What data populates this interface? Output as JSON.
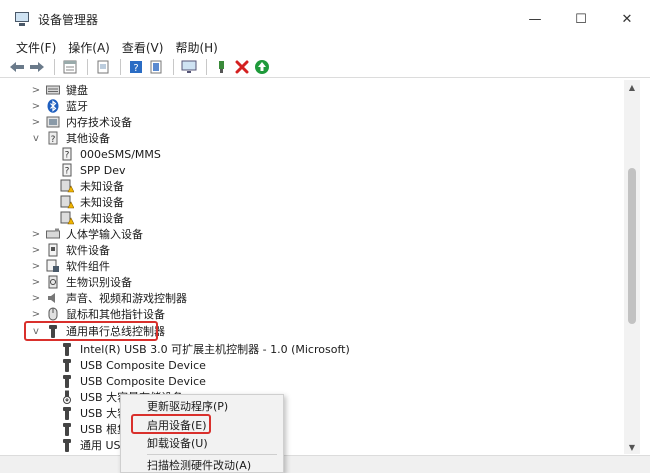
{
  "window": {
    "title": "设备管理器",
    "controls": {
      "minimize": "—",
      "maximize": "☐",
      "close": "✕"
    }
  },
  "menu": [
    "文件(F)",
    "操作(A)",
    "查看(V)",
    "帮助(H)"
  ],
  "toolbar": {
    "buttons": [
      "back-icon",
      "forward-icon",
      "properties-icon",
      "page-icon",
      "help-icon",
      "update-driver-icon",
      "monitor-icon",
      "enable-device-icon",
      "uninstall-icon",
      "scan-hardware-icon"
    ]
  },
  "tree": [
    {
      "label": "键盘",
      "chevron": ">",
      "icon": "keyboard-icon"
    },
    {
      "label": "蓝牙",
      "chevron": ">",
      "icon": "bluetooth-icon"
    },
    {
      "label": "内存技术设备",
      "chevron": ">",
      "icon": "memory-icon"
    },
    {
      "label": "其他设备",
      "chevron": "v",
      "icon": "other-devices-icon"
    },
    {
      "label": "000eSMS/MMS",
      "icon": "unknown-device-icon"
    },
    {
      "label": "SPP Dev",
      "icon": "unknown-device-icon"
    },
    {
      "label": "未知设备",
      "icon": "warning-device-icon"
    },
    {
      "label": "未知设备",
      "icon": "warning-device-icon"
    },
    {
      "label": "未知设备",
      "icon": "warning-device-icon"
    },
    {
      "label": "人体学输入设备",
      "chevron": ">",
      "icon": "hid-icon"
    },
    {
      "label": "软件设备",
      "chevron": ">",
      "icon": "software-device-icon"
    },
    {
      "label": "软件组件",
      "chevron": ">",
      "icon": "software-component-icon"
    },
    {
      "label": "生物识别设备",
      "chevron": ">",
      "icon": "biometric-icon"
    },
    {
      "label": "声音、视频和游戏控制器",
      "chevron": ">",
      "icon": "sound-icon"
    },
    {
      "label": "鼠标和其他指针设备",
      "chevron": ">",
      "icon": "mouse-icon"
    },
    {
      "label": "通用串行总线控制器",
      "chevron": "v",
      "icon": "usb-icon"
    },
    {
      "label": "Intel(R) USB 3.0 可扩展主机控制器 - 1.0 (Microsoft)",
      "icon": "usb-icon"
    },
    {
      "label": "USB Composite Device",
      "icon": "usb-icon"
    },
    {
      "label": "USB Composite Device",
      "icon": "usb-icon"
    },
    {
      "label": "USB 大容量存储设备",
      "icon": "usb-disabled-icon"
    },
    {
      "label": "USB 大容",
      "icon": "usb-icon"
    },
    {
      "label": "USB 根集",
      "icon": "usb-icon"
    },
    {
      "label": "通用 USB",
      "icon": "usb-icon"
    }
  ],
  "context_menu": {
    "items": [
      "更新驱动程序(P)",
      "启用设备(E)",
      "卸载设备(U)",
      "扫描检测硬件改动(A)"
    ]
  },
  "colors": {
    "highlight_border": "#d9302c",
    "accent": "#0a64ad"
  }
}
